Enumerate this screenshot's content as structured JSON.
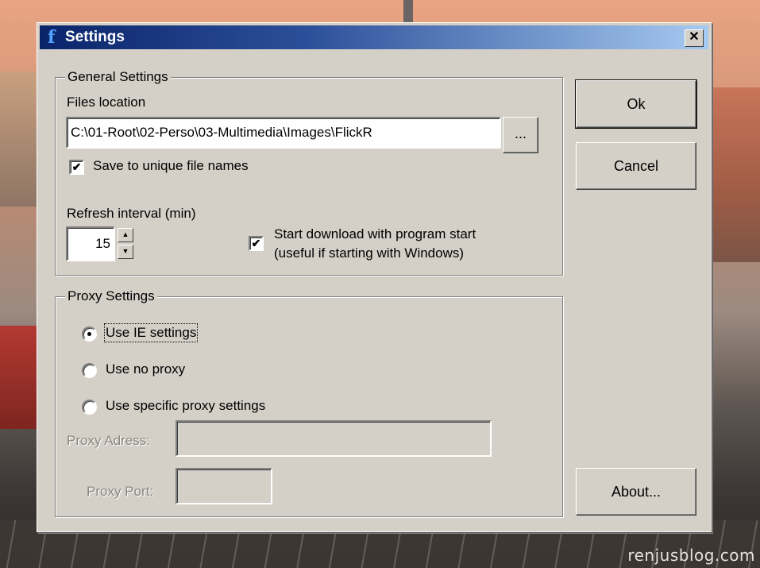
{
  "window": {
    "title": "Settings",
    "close_symbol": "✕"
  },
  "general": {
    "group_label": "General Settings",
    "files_location_label": "Files location",
    "files_location_value": "C:\\01-Root\\02-Perso\\03-Multimedia\\Images\\FlickR",
    "browse_label": "...",
    "unique_names_label": "Save to unique file names",
    "unique_names_checked": true,
    "refresh_label": "Refresh interval (min)",
    "refresh_value": "15",
    "start_download_line1": "Start download with program start",
    "start_download_line2": "(useful if starting with Windows)",
    "start_download_checked": true
  },
  "proxy": {
    "group_label": "Proxy Settings",
    "options": [
      {
        "label": "Use IE settings",
        "checked": true
      },
      {
        "label": "Use no proxy",
        "checked": false
      },
      {
        "label": "Use specific proxy settings",
        "checked": false
      }
    ],
    "address_label": "Proxy Adress:",
    "address_value": "",
    "port_label": "Proxy Port:",
    "port_value": ""
  },
  "buttons": {
    "ok": "Ok",
    "cancel": "Cancel",
    "about": "About..."
  },
  "watermark": "renjusblog.com",
  "icons": {
    "app": "flickr-f-icon",
    "check": "✔",
    "spin_up": "▲",
    "spin_down": "▼"
  }
}
